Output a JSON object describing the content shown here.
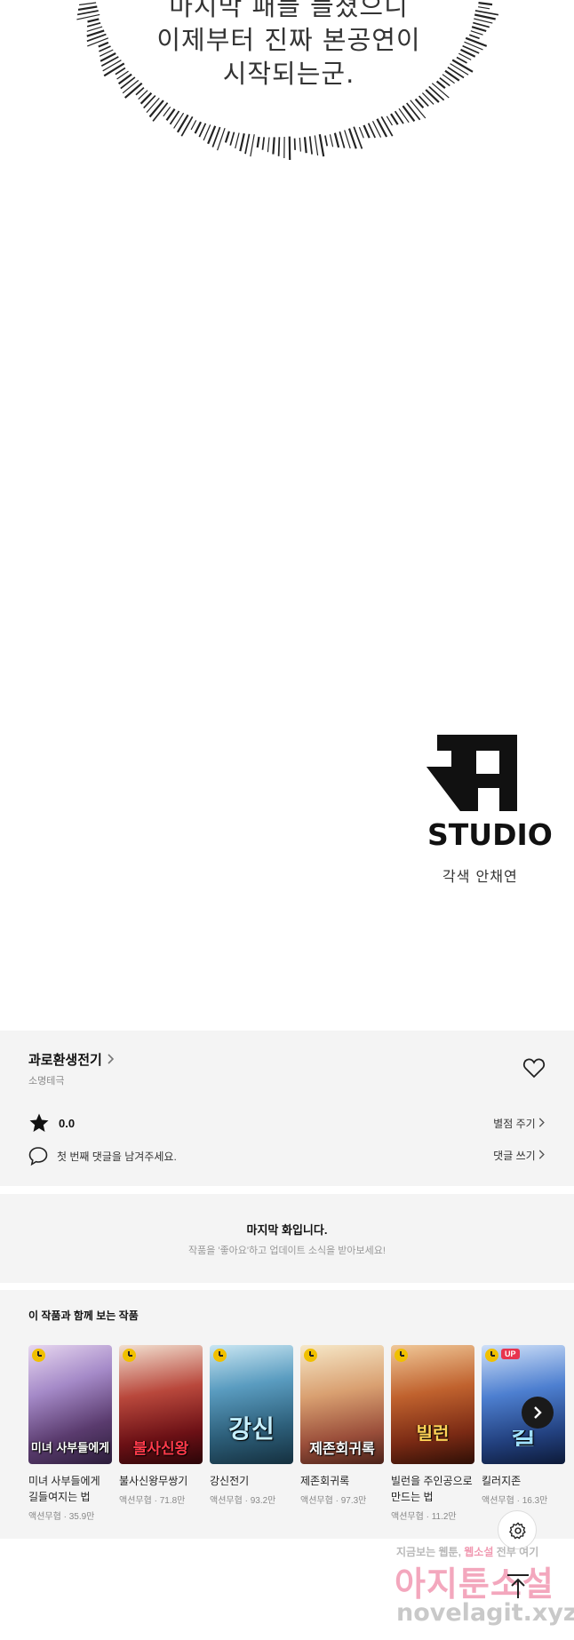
{
  "comic": {
    "bubble_lines": [
      "마지막 패들 들쳤으니",
      "이제부터 진짜 본공연이",
      "시작되는군."
    ],
    "studio_word": "STUDIO",
    "studio_credit": "각색 안채연"
  },
  "info": {
    "series_title": "과로환생전기",
    "author": "소명테극",
    "rating_value": "0.0",
    "rate_link": "별점 주기",
    "comment_prompt": "첫 번째 댓글을 남겨주세요.",
    "comment_link": "댓글 쓰기"
  },
  "end_notice": {
    "title": "마지막 화입니다.",
    "subtitle": "작품을 '좋아요'하고 업데이트 소식을 받아보세요!"
  },
  "recommendations": {
    "heading": "이 작품과 함께 보는 작품",
    "items": [
      {
        "name": "미녀 사부들에게 길들여지는 법",
        "thumb_text": "미녀 사부들에게",
        "genre": "액션무협",
        "views": "35.9만",
        "badge": ""
      },
      {
        "name": "불사신왕무쌍기",
        "thumb_text": "불사신왕",
        "genre": "액션무협",
        "views": "71.8만",
        "badge": ""
      },
      {
        "name": "강신전기",
        "thumb_text": "강신",
        "genre": "액션무협",
        "views": "93.2만",
        "badge": ""
      },
      {
        "name": "제존회귀록",
        "thumb_text": "제존회귀록",
        "genre": "액션무협",
        "views": "97.3만",
        "badge": ""
      },
      {
        "name": "빌런을 주인공으로 만드는 법",
        "thumb_text": "빌런",
        "genre": "액션무협",
        "views": "11.2만",
        "badge": ""
      },
      {
        "name": "킬러지존",
        "thumb_text": "킬",
        "genre": "액션무협",
        "views": "16.3만",
        "badge": "UP"
      }
    ]
  },
  "watermark": {
    "top_text_a": "지금보는 웹툰,",
    "top_text_b": "웹소설",
    "top_text_c": "전부 여기",
    "main": "아지툰소설",
    "url": "novelagit.xyz"
  },
  "colors": {
    "panel_bg": "#f4f4f4",
    "badge_red": "#e8344e",
    "clock_yellow": "#f0c000"
  },
  "icons": [
    "heart-icon",
    "star-icon",
    "comment-bubble-icon",
    "chevron-right-icon",
    "gear-icon",
    "arrow-up-icon",
    "clock-icon"
  ]
}
